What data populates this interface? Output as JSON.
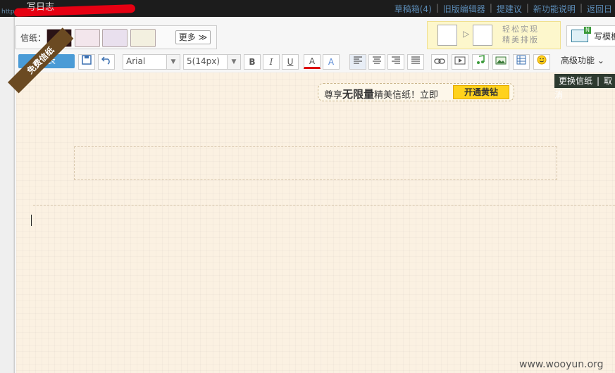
{
  "topbar": {
    "title": "写日志",
    "url_fragment": "http",
    "links": [
      "草稿箱(4)",
      "旧版编辑器",
      "提建议",
      "新功能说明",
      "返回日"
    ],
    "separator": "|"
  },
  "stationery": {
    "label": "信纸：",
    "more_label": "更多 ≫"
  },
  "promo_banner": {
    "text_line1": "轻松实现",
    "text_line2": "精美排版",
    "arrow": "▷"
  },
  "template_button": {
    "label": "写模板",
    "badge": "N"
  },
  "toolbar": {
    "send_label": "发表",
    "font_family": "Arial",
    "font_size": "5(14px)",
    "bold": "B",
    "italic": "I",
    "underline": "U",
    "font_color": "A",
    "bg_color": "A",
    "advanced_label": "高级功能 ⌄"
  },
  "paper": {
    "ribbon_label": "免费信纸",
    "vip_prefix": "尊享",
    "vip_bold": "无限量",
    "vip_suffix": "精美信纸！立即",
    "vip_button": "开通黄钻",
    "change_label": "更换信纸",
    "cancel_label": "取消"
  },
  "watermark": "www.wooyun.org",
  "colors": {
    "topbar_bg": "#1c1c1c",
    "send_button": "#4a9bd6",
    "paper_bg": "#fbf1e2",
    "ribbon": "#6b4a22",
    "vip_button": "#ffd21d"
  }
}
